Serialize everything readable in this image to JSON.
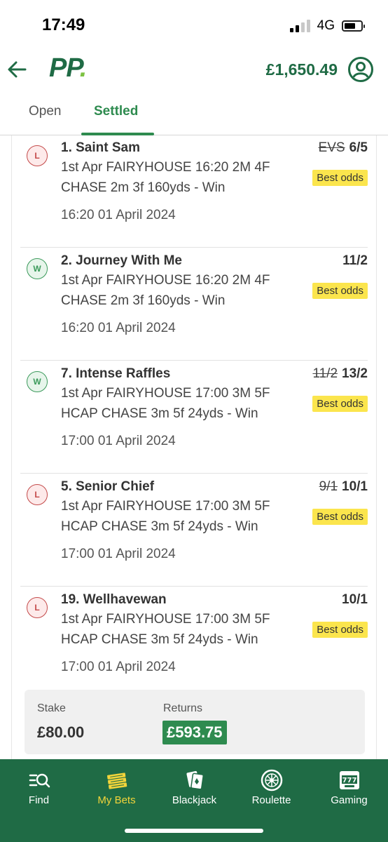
{
  "status_bar": {
    "time": "17:49",
    "network": "4G"
  },
  "header": {
    "balance": "£1,650.49"
  },
  "tabs": [
    {
      "label": "Open"
    },
    {
      "label": "Settled"
    }
  ],
  "selections": [
    {
      "result": "L",
      "name": "1. Saint Sam",
      "line1": "1st Apr FAIRYHOUSE 16:20 2M 4F",
      "line2": "CHASE 2m 3f 160yds - Win",
      "time": "16:20 01 April 2024",
      "old_odds": "EVS",
      "odds": "6/5",
      "badge": "Best odds"
    },
    {
      "result": "W",
      "name": "2. Journey With Me",
      "line1": "1st Apr FAIRYHOUSE 16:20 2M 4F",
      "line2": "CHASE 2m 3f 160yds - Win",
      "time": "16:20 01 April 2024",
      "old_odds": "",
      "odds": "11/2",
      "badge": "Best odds"
    },
    {
      "result": "W",
      "name": "7. Intense Raffles",
      "line1": "1st Apr FAIRYHOUSE 17:00 3M 5F",
      "line2": "HCAP CHASE 3m 5f 24yds - Win",
      "time": "17:00 01 April 2024",
      "old_odds": "11/2",
      "odds": "13/2",
      "badge": "Best odds"
    },
    {
      "result": "L",
      "name": "5. Senior Chief",
      "line1": "1st Apr FAIRYHOUSE 17:00 3M 5F",
      "line2": "HCAP CHASE 3m 5f 24yds - Win",
      "time": "17:00 01 April 2024",
      "old_odds": "9/1",
      "odds": "10/1",
      "badge": "Best odds"
    },
    {
      "result": "L",
      "name": "19. Wellhavewan",
      "line1": "1st Apr FAIRYHOUSE 17:00 3M 5F",
      "line2": "HCAP CHASE 3m 5f 24yds - Win",
      "time": "17:00 01 April 2024",
      "old_odds": "",
      "odds": "10/1",
      "badge": "Best odds"
    }
  ],
  "summary": {
    "stake_label": "Stake",
    "stake": "£80.00",
    "returns_label": "Returns",
    "returns": "£593.75"
  },
  "bottom_nav": [
    {
      "label": "Find",
      "icon": "search-list-icon"
    },
    {
      "label": "My Bets",
      "icon": "bet-slips-icon"
    },
    {
      "label": "Blackjack",
      "icon": "playing-cards-icon"
    },
    {
      "label": "Roulette",
      "icon": "roulette-wheel-icon"
    },
    {
      "label": "Gaming",
      "icon": "slot-machine-icon"
    }
  ],
  "colors": {
    "brand_green": "#1f6b45",
    "accent_green": "#2e8b4f",
    "logo_dot": "#7dc242",
    "best_odds_yellow": "#fbe54d",
    "active_nav": "#f2d43a",
    "lost": "#c44a4a",
    "won": "#3b9a5b"
  }
}
